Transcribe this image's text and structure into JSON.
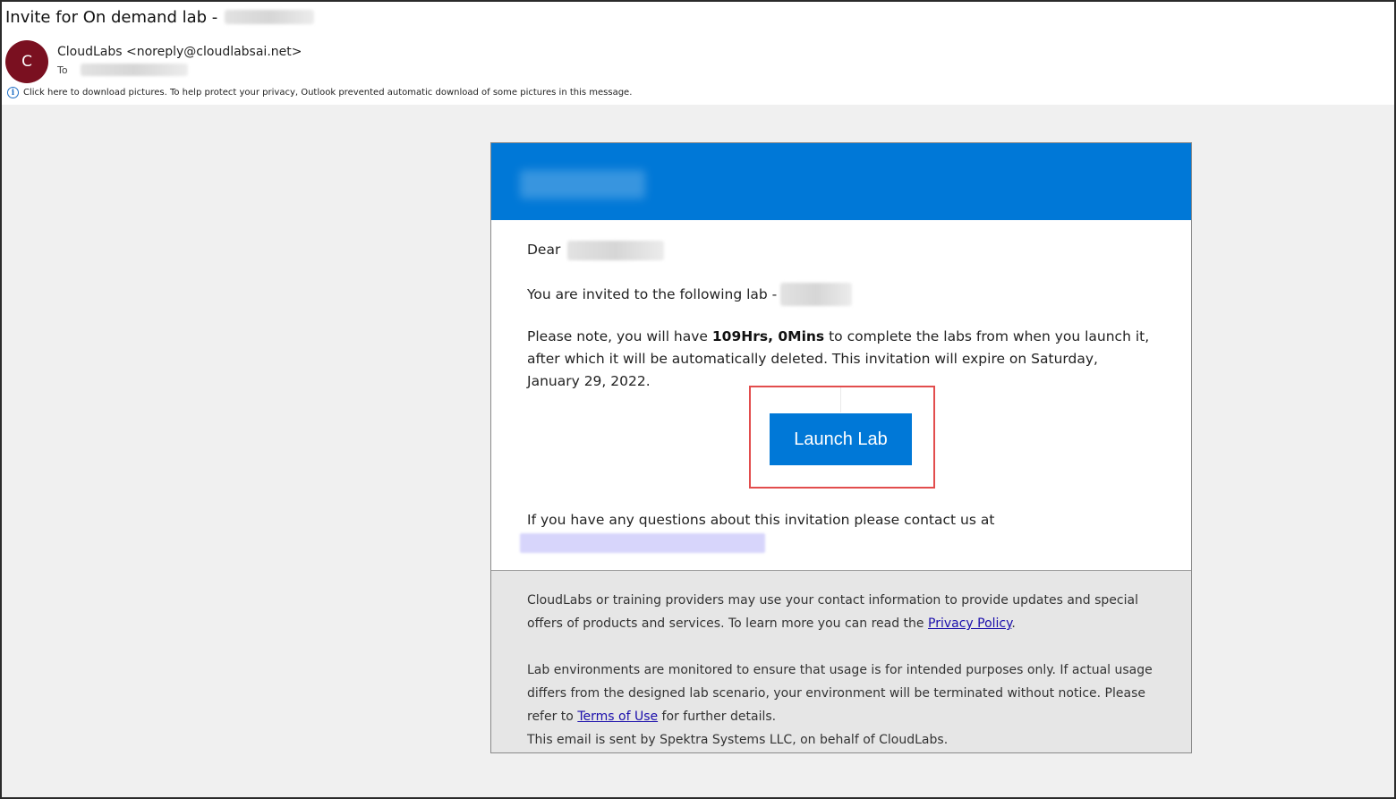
{
  "header": {
    "subject": "Invite for On demand lab -",
    "avatar_initial": "C",
    "sender": "CloudLabs <noreply@cloudlabsai.net>",
    "to_label": "To",
    "info_icon": "info-icon",
    "info_text": "Click here to download pictures. To help protect your privacy, Outlook prevented automatic download of some pictures in this message."
  },
  "email": {
    "greeting": "Dear",
    "invite_text": "You are invited to the following lab -",
    "note_prefix": "Please note, you will have ",
    "note_bold": "109Hrs, 0Mins",
    "note_suffix": " to complete the labs from when you launch it, after which it will be automatically deleted. This invitation will expire on Saturday, January 29, 2022.",
    "launch_button": "Launch Lab",
    "questions_text": "If you have any questions about this invitation please contact us at"
  },
  "footer": {
    "para1_text": "CloudLabs or training providers may use your contact information to provide updates and special offers of products and services. To learn more you can read the ",
    "privacy_link": "Privacy Policy",
    "para1_end": ".",
    "para2_text": "Lab environments are monitored to ensure that usage is for intended purposes only. If actual usage differs from the designed lab scenario, your environment will be terminated without notice. Please refer to ",
    "terms_link": "Terms of Use",
    "para2_end": " for further details.",
    "sent_by": "This email is sent by Spektra Systems LLC, on behalf of CloudLabs."
  },
  "colors": {
    "brand_blue": "#0078d7",
    "avatar": "#7a1020",
    "highlight": "#e24d4d"
  }
}
